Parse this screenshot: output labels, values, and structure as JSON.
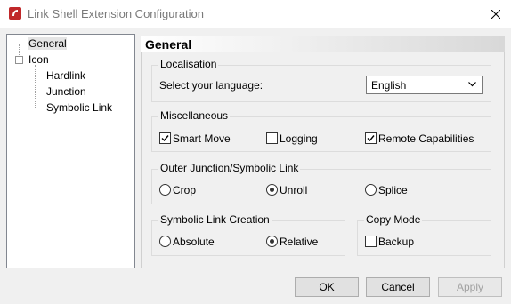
{
  "window": {
    "title": "Link Shell Extension Configuration",
    "accent_color": "#c0282a"
  },
  "tree": {
    "items": [
      {
        "label": "General",
        "selected": true
      },
      {
        "label": "Icon"
      },
      {
        "label": "Hardlink"
      },
      {
        "label": "Junction"
      },
      {
        "label": "Symbolic Link"
      }
    ]
  },
  "panel": {
    "title": "General",
    "localisation": {
      "legend": "Localisation",
      "language_label": "Select your language:",
      "language_value": "English"
    },
    "misc": {
      "legend": "Miscellaneous",
      "smart_move": {
        "label": "Smart Move",
        "checked": true
      },
      "logging": {
        "label": "Logging",
        "checked": false
      },
      "remote": {
        "label": "Remote Capabilities",
        "checked": true
      }
    },
    "outer": {
      "legend": "Outer Junction/Symbolic Link",
      "crop": "Crop",
      "unroll": "Unroll",
      "splice": "Splice",
      "selected": "Unroll"
    },
    "symlink": {
      "legend": "Symbolic Link Creation",
      "absolute": "Absolute",
      "relative": "Relative",
      "selected": "Relative"
    },
    "copy": {
      "legend": "Copy Mode",
      "backup": {
        "label": "Backup",
        "checked": false
      }
    }
  },
  "buttons": {
    "ok": "OK",
    "cancel": "Cancel",
    "apply": "Apply"
  }
}
